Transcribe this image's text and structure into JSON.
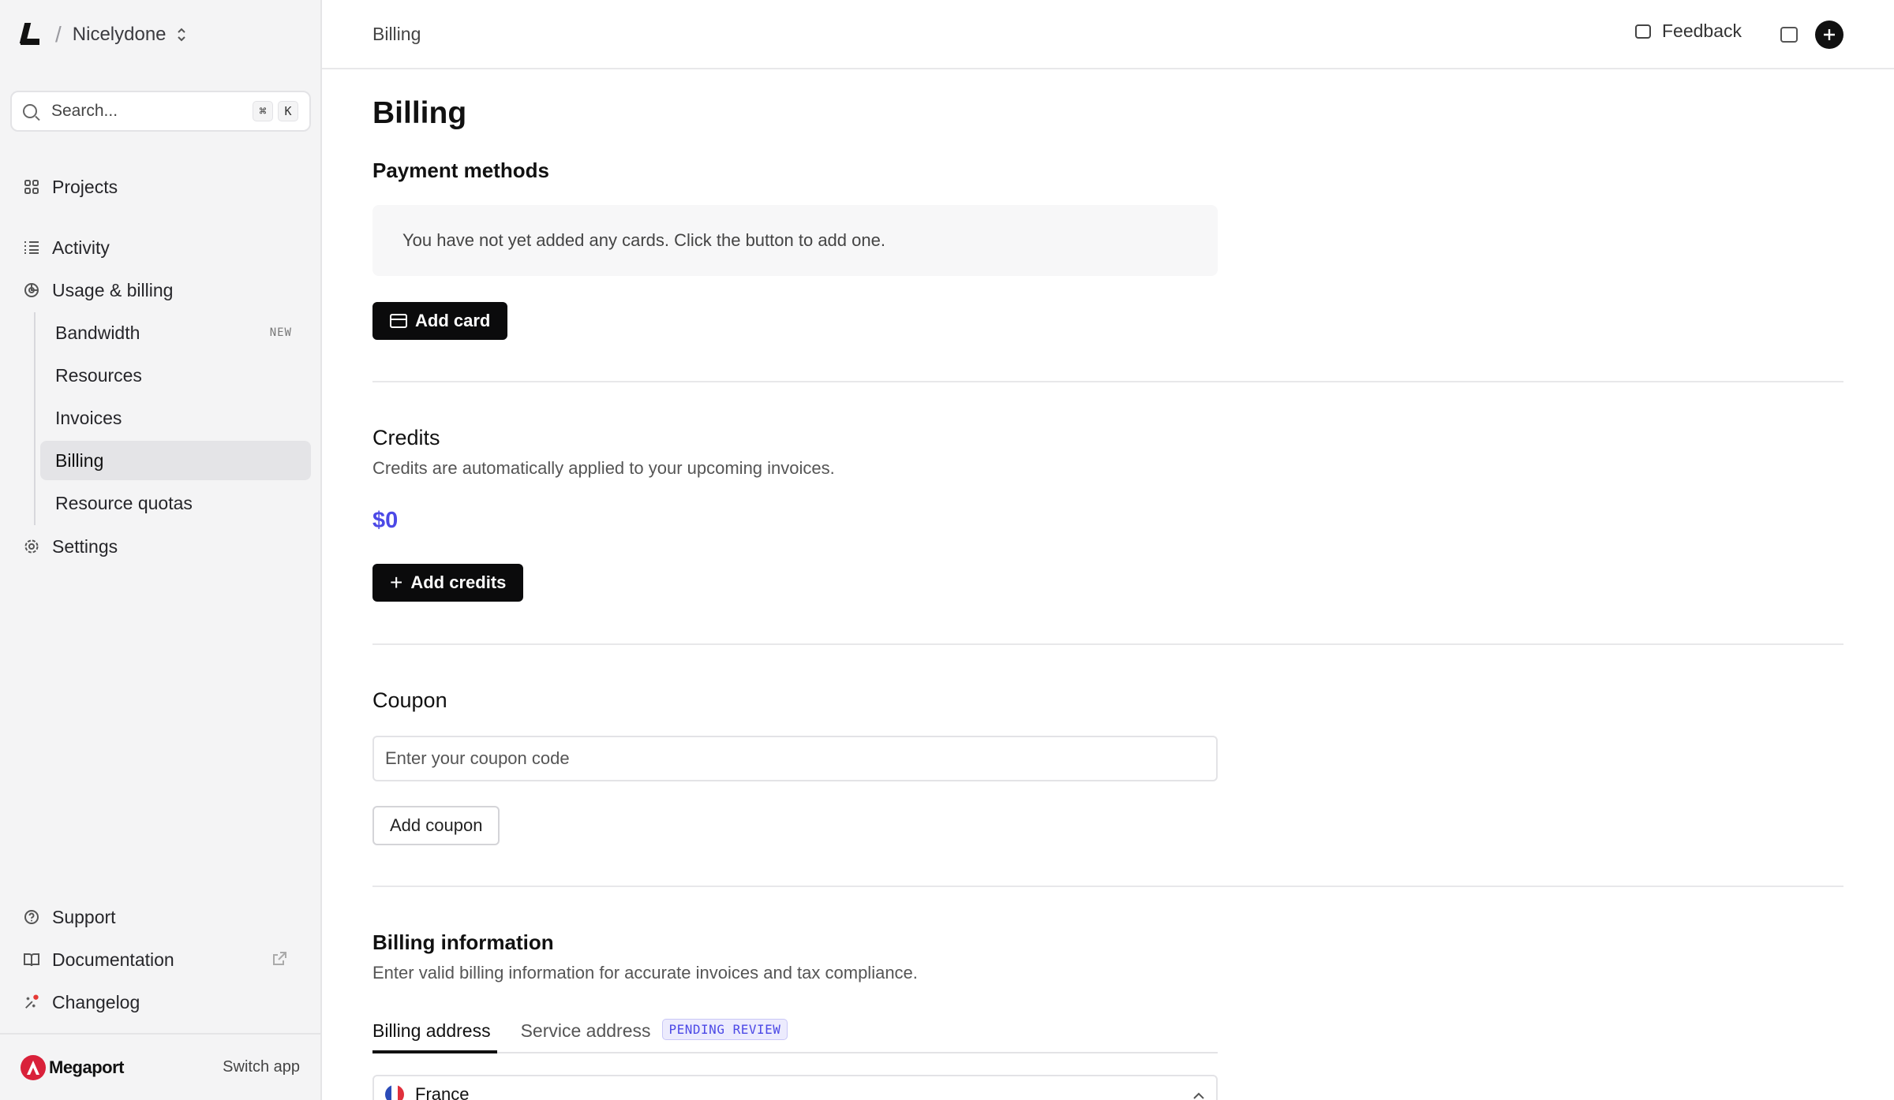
{
  "org": {
    "name": "Nicelydone"
  },
  "search": {
    "placeholder": "Search...",
    "kbd1": "⌘",
    "kbd2": "K"
  },
  "sidebar": {
    "projects": "Projects",
    "activity": "Activity",
    "usage_billing": "Usage & billing",
    "sub_items": [
      {
        "label": "Bandwidth",
        "badge": "NEW"
      },
      {
        "label": "Resources"
      },
      {
        "label": "Invoices"
      },
      {
        "label": "Billing",
        "active": true
      },
      {
        "label": "Resource quotas"
      }
    ],
    "settings": "Settings",
    "support": "Support",
    "documentation": "Documentation",
    "changelog": "Changelog"
  },
  "footer": {
    "brand": "Megaport",
    "switch_app": "Switch app"
  },
  "topbar": {
    "breadcrumb": "Billing",
    "feedback": "Feedback"
  },
  "page": {
    "title": "Billing",
    "payment": {
      "heading": "Payment methods",
      "empty": "You have not yet added any cards. Click the button to add one.",
      "add_card": "Add card"
    },
    "credits": {
      "heading": "Credits",
      "description": "Credits are automatically applied to your upcoming invoices.",
      "amount": "$0",
      "add_credits": "Add credits"
    },
    "coupon": {
      "heading": "Coupon",
      "placeholder": "Enter your coupon code",
      "add_coupon": "Add coupon"
    },
    "billing_info": {
      "heading": "Billing information",
      "description": "Enter valid billing information for accurate invoices and tax compliance.",
      "tabs": [
        {
          "label": "Billing address",
          "active": true
        },
        {
          "label": "Service address",
          "badge": "PENDING REVIEW"
        }
      ],
      "country": "France"
    }
  },
  "colors": {
    "accent": "#4c49e6",
    "brand": "#d9213a"
  }
}
